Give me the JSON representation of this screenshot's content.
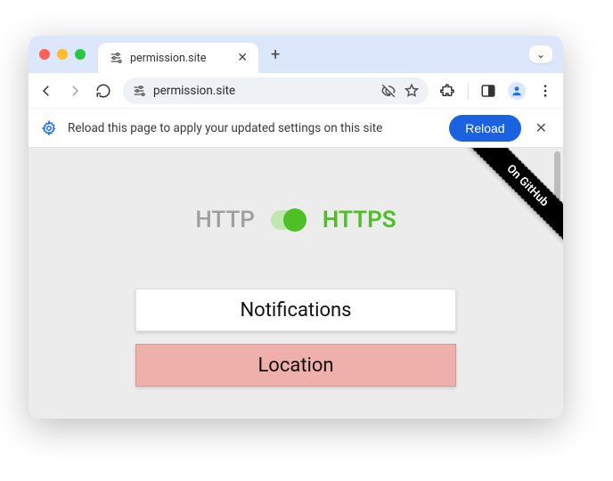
{
  "window": {
    "dropdown_icon": "⌄"
  },
  "tabs": {
    "active": {
      "title": "permission.site",
      "favicon_glyph": "⚙"
    },
    "new_tab_label": "+"
  },
  "toolbar": {
    "url": "permission.site"
  },
  "infobar": {
    "message": "Reload this page to apply your updated settings on this site",
    "reload_label": "Reload"
  },
  "content": {
    "http_label": "HTTP",
    "https_label": "HTTPS",
    "github_ribbon": "On GitHub",
    "buttons": {
      "notifications": "Notifications",
      "location": "Location"
    }
  }
}
